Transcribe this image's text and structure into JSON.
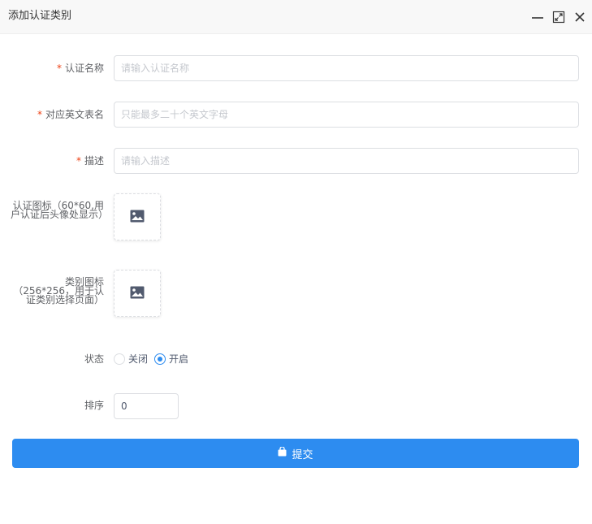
{
  "dialog": {
    "title": "添加认证类别",
    "controls": [
      "minimize-icon",
      "maximize-icon",
      "close-icon"
    ]
  },
  "form": {
    "name": {
      "label": "认证名称",
      "required": true,
      "placeholder": "请输入认证名称",
      "value": ""
    },
    "table_name": {
      "label": "对应英文表名",
      "required": true,
      "placeholder": "只能最多二十个英文字母",
      "value": ""
    },
    "description": {
      "label": "描述",
      "required": true,
      "placeholder": "请输入描述",
      "value": ""
    },
    "cert_icon": {
      "label": "认证图标（60*60,用户认证后头像处显示）",
      "icon": "image-icon"
    },
    "category_icon": {
      "label": "类别图标（256*256，用于认证类别选择页面）",
      "icon": "image-icon"
    },
    "status": {
      "label": "状态",
      "options": [
        {
          "label": "关闭",
          "checked": false
        },
        {
          "label": "开启",
          "checked": true
        }
      ]
    },
    "sort": {
      "label": "排序",
      "value": "0"
    }
  },
  "submit": {
    "label": "提交",
    "icon": "bag-icon"
  },
  "colors": {
    "primary": "#2d8cf0",
    "required": "#ed4014",
    "border": "#dcdee2",
    "titlebar": "#f8f8f8"
  }
}
